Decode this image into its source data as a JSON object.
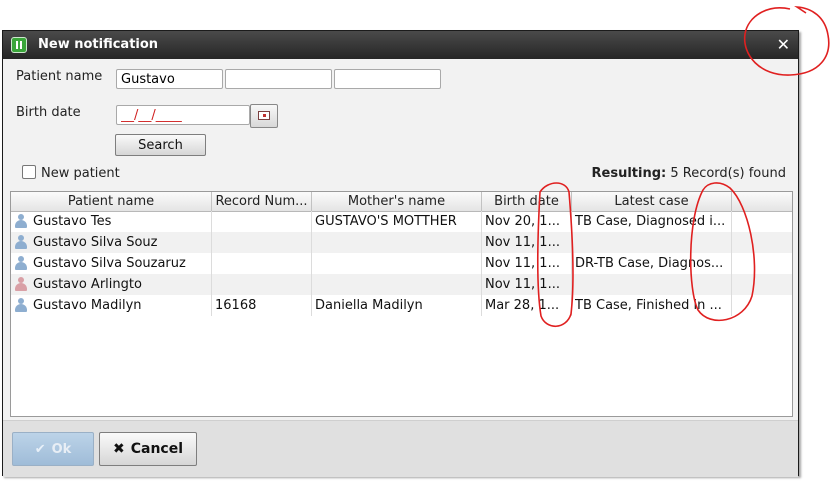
{
  "window": {
    "title": "New notification",
    "close_icon": "close-icon",
    "app_icon": "app-logo-icon"
  },
  "form": {
    "patient_name_label": "Patient name",
    "name_fields": [
      "Gustavo",
      "",
      ""
    ],
    "birth_date_label": "Birth date",
    "birth_date_value": "__/__/____",
    "calendar_icon": "calendar-icon",
    "search_label": "Search",
    "new_patient_label": "New patient",
    "new_patient_checked": false,
    "result_prefix": "Resulting:",
    "result_text": "5 Record(s) found"
  },
  "table": {
    "columns": [
      "Patient name",
      "Record Num...",
      "Mother's name",
      "Birth date",
      "Latest case"
    ],
    "rows": [
      {
        "icon": "male-patient-icon",
        "name": "Gustavo  Tes",
        "record": "",
        "mother": "GUSTAVO'S MOTTHER",
        "birth": "Nov 20, 1...",
        "case": "TB Case, Diagnosed i..."
      },
      {
        "icon": "male-patient-icon",
        "name": "Gustavo Silva Souz",
        "record": "",
        "mother": "",
        "birth": "Nov 11, 1...",
        "case": ""
      },
      {
        "icon": "male-patient-icon",
        "name": "Gustavo Silva Souzaruz",
        "record": "",
        "mother": "",
        "birth": "Nov 11, 1...",
        "case": "DR-TB Case, Diagnos..."
      },
      {
        "icon": "female-patient-icon",
        "name": "Gustavo  Arlingto",
        "record": "",
        "mother": "",
        "birth": "Nov 11, 1...",
        "case": ""
      },
      {
        "icon": "male-patient-icon",
        "name": "Gustavo Madilyn",
        "record": "16168",
        "mother": "Daniella Madilyn",
        "birth": "Mar 28, 1...",
        "case": "TB Case, Finished in ..."
      }
    ]
  },
  "footer": {
    "ok_label": "Ok",
    "cancel_label": "Cancel",
    "ok_enabled": false
  },
  "annotation_color": "#e02020"
}
